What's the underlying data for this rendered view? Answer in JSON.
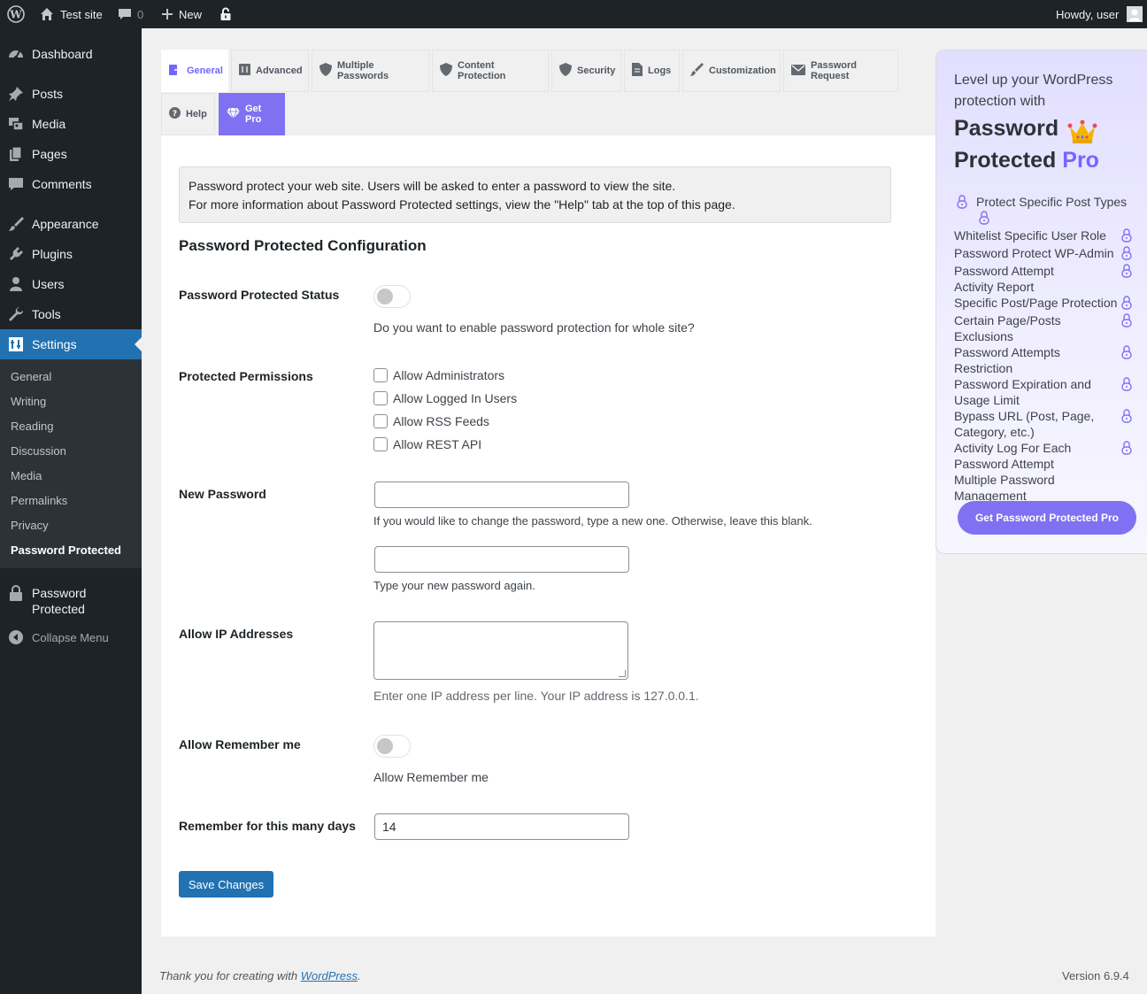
{
  "admin_bar": {
    "site_name": "Test site",
    "comments_count": "0",
    "new_label": "New",
    "howdy": "Howdy, user"
  },
  "sidebar": {
    "items": [
      {
        "label": "Dashboard",
        "icon": "dashboard-icon"
      },
      {
        "label": "Posts",
        "icon": "pin-icon"
      },
      {
        "label": "Media",
        "icon": "media-icon"
      },
      {
        "label": "Pages",
        "icon": "pages-icon"
      },
      {
        "label": "Comments",
        "icon": "comment-icon"
      },
      {
        "label": "Appearance",
        "icon": "brush-icon"
      },
      {
        "label": "Plugins",
        "icon": "plug-icon"
      },
      {
        "label": "Users",
        "icon": "user-icon"
      },
      {
        "label": "Tools",
        "icon": "wrench-icon"
      },
      {
        "label": "Settings",
        "icon": "settings-icon"
      }
    ],
    "submenu": [
      "General",
      "Writing",
      "Reading",
      "Discussion",
      "Media",
      "Permalinks",
      "Privacy",
      "Password Protected"
    ],
    "plugin_label_1": "Password",
    "plugin_label_2": "Protected",
    "collapse_label": "Collapse Menu"
  },
  "tabs": [
    {
      "label": "General",
      "icon": "general-icon"
    },
    {
      "label": "Advanced",
      "icon": "advanced-icon"
    },
    {
      "label": "Multiple Passwords",
      "icon": "shield-icon"
    },
    {
      "label": "Content Protection",
      "icon": "shield-icon"
    },
    {
      "label": "Security",
      "icon": "shield-icon"
    },
    {
      "label": "Logs",
      "icon": "document-icon"
    },
    {
      "label": "Customization",
      "icon": "brush-icon"
    },
    {
      "label": "Password Request",
      "icon": "mail-icon"
    },
    {
      "label": "Help",
      "icon": "help-icon"
    },
    {
      "label": "Get Pro",
      "icon": "diamond-icon"
    }
  ],
  "notice": {
    "line1": "Password protect your web site. Users will be asked to enter a password to view the site.",
    "line2": "For more information about Password Protected settings, view the \"Help\" tab at the top of this page."
  },
  "config": {
    "heading": "Password Protected Configuration",
    "status_label": "Password Protected Status",
    "status_desc": "Do you want to enable password protection for whole site?",
    "permissions_label": "Protected Permissions",
    "permissions": [
      "Allow Administrators",
      "Allow Logged In Users",
      "Allow RSS Feeds",
      "Allow REST API"
    ],
    "new_password_label": "New Password",
    "new_password_desc": "If you would like to change the password, type a new one. Otherwise, leave this blank.",
    "confirm_password_desc": "Type your new password again.",
    "ip_label": "Allow IP Addresses",
    "ip_desc": "Enter one IP address per line. Your IP address is 127.0.0.1.",
    "remember_label": "Allow Remember me",
    "remember_desc": "Allow Remember me",
    "days_label": "Remember for this many days",
    "days_value": "14",
    "save_label": "Save Changes"
  },
  "promo": {
    "lead": "Level up your WordPress protection with",
    "title_part1": "Password",
    "title_part2": "Protected",
    "title_pro": "Pro",
    "features": [
      "Protect Specific Post Types",
      "Whitelist Specific User Role",
      "Password Protect WP-Admin",
      "Password Attempt Activity Report",
      "Specific Post/Page Protection",
      "Certain Page/Posts Exclusions",
      "Password Attempts Restriction",
      "Password Expiration and Usage Limit",
      "Bypass URL (Post, Page, Category, etc.)",
      "Activity Log For Each Password Attempt",
      "Multiple Password Management"
    ],
    "button_label": "Get Password Protected Pro"
  },
  "footer": {
    "text_before": "Thank you for creating with ",
    "link": "WordPress",
    "text_after": ".",
    "version": "Version 6.9.4"
  },
  "colors": {
    "accent": "#7366ff",
    "wp_blue": "#2271b1",
    "admin_dark": "#1d2327"
  }
}
